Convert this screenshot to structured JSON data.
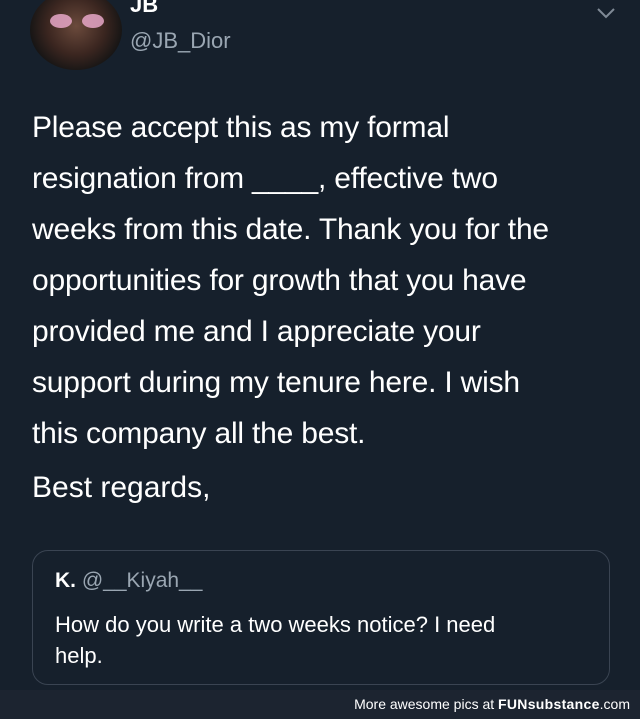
{
  "tweet": {
    "display_name": "JB",
    "handle": "@JB_Dior",
    "body_lines": [
      "Please accept this as my formal",
      "resignation from ____, effective two",
      "weeks from this date. Thank you for the",
      "opportunities for growth that you have",
      "provided me and I appreciate your",
      "support during my tenure here. I wish",
      "this company all the best."
    ],
    "closing": "Best regards,"
  },
  "quoted_tweet": {
    "name": "K.",
    "handle": "@__Kiyah__",
    "text_lines": [
      "How do you write a two weeks notice? I need",
      "help."
    ]
  },
  "footer": {
    "prefix": "More awesome pics at",
    "brand": "FUNsubstance",
    "suffix": ".com"
  },
  "icons": {
    "menu": "chevron-down-icon",
    "avatar": "profile-photo"
  },
  "colors": {
    "background": "#16202c",
    "secondary_text": "#9aa6b2",
    "border": "#3a4452"
  }
}
